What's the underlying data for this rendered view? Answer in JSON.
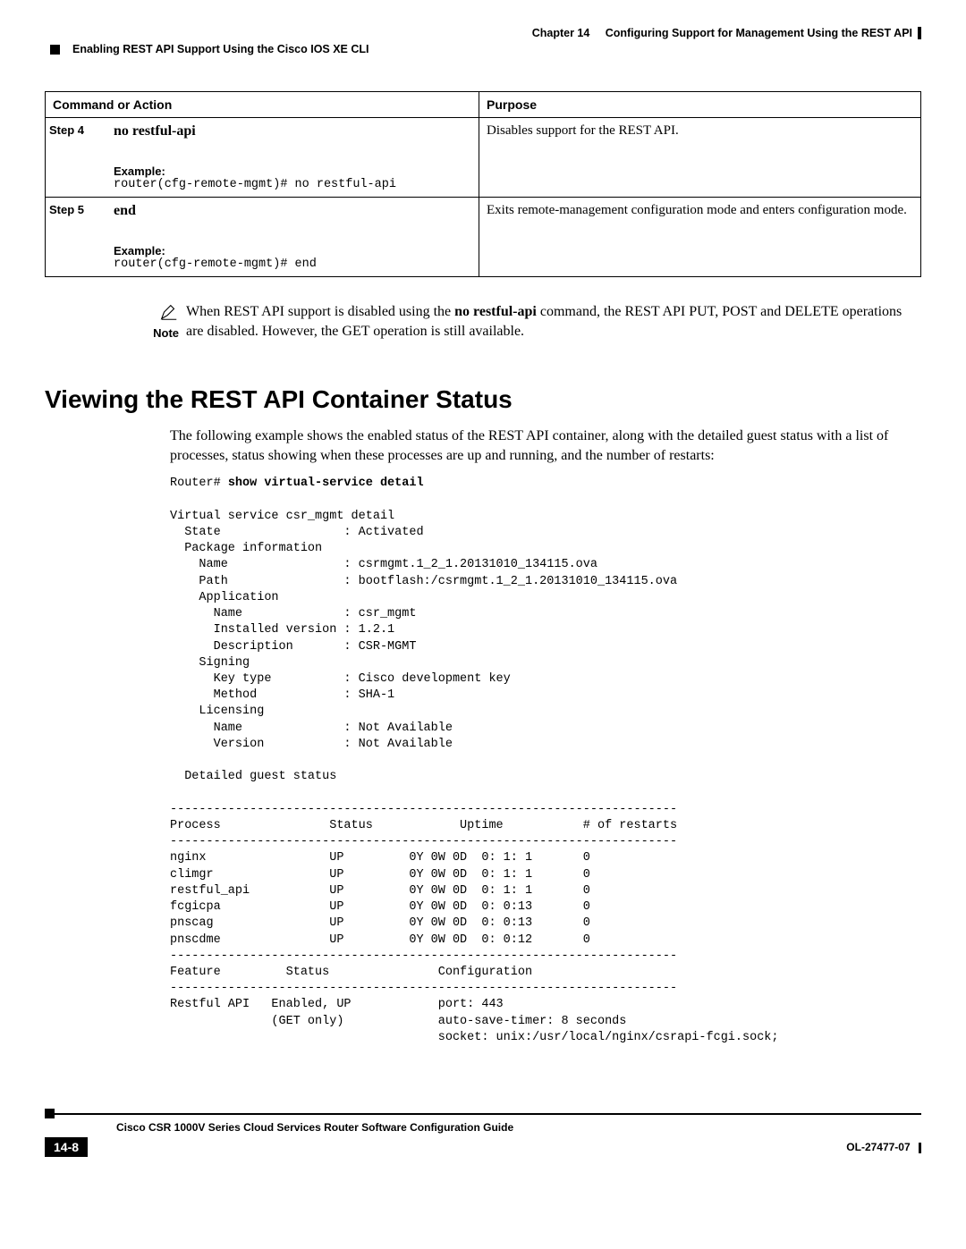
{
  "header": {
    "chapter": "Chapter 14",
    "chapter_title": "Configuring Support for Management Using the REST API",
    "section": "Enabling REST API Support Using the Cisco IOS XE CLI"
  },
  "table": {
    "headers": {
      "cmd": "Command or Action",
      "purpose": "Purpose"
    },
    "rows": [
      {
        "step": "Step 4",
        "command": "no restful-api",
        "example_label": "Example:",
        "example": "router(cfg-remote-mgmt)# no restful-api",
        "purpose": "Disables support for the REST API."
      },
      {
        "step": "Step 5",
        "command": "end",
        "example_label": "Example:",
        "example": "router(cfg-remote-mgmt)# end",
        "purpose": "Exits remote-management configuration mode and enters configuration mode."
      }
    ]
  },
  "note": {
    "label": "Note",
    "text_1": "When REST API support is disabled using the ",
    "bold_cmd": "no restful-api",
    "text_2": " command, the REST API PUT, POST and DELETE operations are disabled. However, the GET operation is still available."
  },
  "section_heading": "Viewing the REST API Container Status",
  "section_para": "The following example shows the enabled status of the REST API container, along with the detailed guest status with a list of processes, status showing when these processes are up and running, and the number of restarts:",
  "code": {
    "prompt": "Router# ",
    "cmd_bold": "show virtual-service detail",
    "body": "\nVirtual service csr_mgmt detail\n  State                 : Activated\n  Package information\n    Name                : csrmgmt.1_2_1.20131010_134115.ova\n    Path                : bootflash:/csrmgmt.1_2_1.20131010_134115.ova\n    Application\n      Name              : csr_mgmt\n      Installed version : 1.2.1\n      Description       : CSR-MGMT\n    Signing\n      Key type          : Cisco development key\n      Method            : SHA-1\n    Licensing\n      Name              : Not Available\n      Version           : Not Available\n\n  Detailed guest status\n\n----------------------------------------------------------------------\nProcess               Status            Uptime           # of restarts\n----------------------------------------------------------------------\nnginx                 UP         0Y 0W 0D  0: 1: 1       0\nclimgr                UP         0Y 0W 0D  0: 1: 1       0\nrestful_api           UP         0Y 0W 0D  0: 1: 1       0\nfcgicpa               UP         0Y 0W 0D  0: 0:13       0\npnscag                UP         0Y 0W 0D  0: 0:13       0\npnscdme               UP         0Y 0W 0D  0: 0:12       0\n----------------------------------------------------------------------\nFeature         Status               Configuration\n----------------------------------------------------------------------\nRestful API   Enabled, UP            port: 443\n              (GET only)             auto-save-timer: 8 seconds\n                                     socket: unix:/usr/local/nginx/csrapi-fcgi.sock;"
  },
  "footer": {
    "guide_title": "Cisco CSR 1000V Series Cloud Services Router Software Configuration Guide",
    "page": "14-8",
    "docnum": "OL-27477-07"
  }
}
